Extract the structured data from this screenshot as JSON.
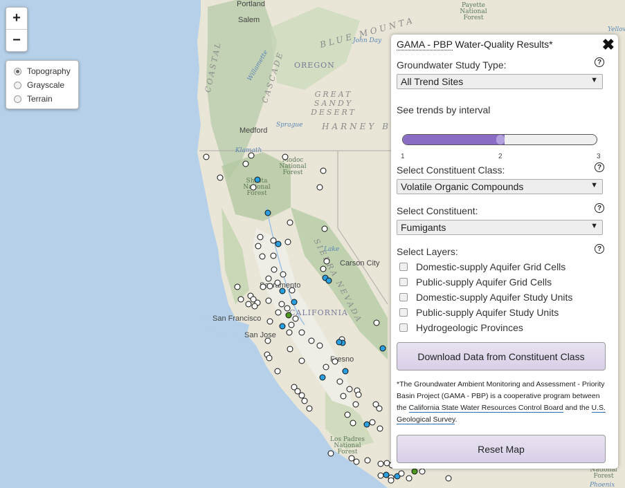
{
  "map": {
    "labels": {
      "portland": "Portland",
      "salem": "Salem",
      "medford": "Medford",
      "carson_city": "Carson City",
      "sacramento": "Sacramento",
      "san_francisco": "San Francisco",
      "san_jose": "San Jose",
      "fresno": "Fresno",
      "oregon": "OREGON",
      "california": "CALIFORNIA",
      "great_sandy_desert": "GREAT SANDY DESERT",
      "harney_basin": "HARNEY B",
      "blue_mountains": "BLUE MOUNTA",
      "coast_ranges": "COASTAL",
      "cascade": "CASCADE",
      "sierra_nevada": "SIERRA NEVADA",
      "modoc_forest": "Modoc National Forest",
      "shasta_forest": "Shasta National Forest",
      "payette_forest": "Payette National Forest",
      "los_padres_forest": "Los Padres National Forest",
      "national_forest_se": "National Forest",
      "john_day": "John Day",
      "klamath": "Klamath",
      "sprague": "Sprague",
      "willamette": "Willamette",
      "lake": "Lake",
      "phoenix": "Phoenix",
      "yellow": "Yellow"
    },
    "site_colors": {
      "empty": "#ffffff",
      "blue": "#2aa0e0",
      "green": "#4f9b1f"
    }
  },
  "zoom": {
    "in_label": "+",
    "out_label": "−"
  },
  "basemap": {
    "options": [
      {
        "label": "Topography",
        "selected": true
      },
      {
        "label": "Grayscale",
        "selected": false
      },
      {
        "label": "Terrain",
        "selected": false
      }
    ]
  },
  "panel": {
    "title_abbr": "GAMA - PBP",
    "title_rest": " Water-Quality Results*",
    "close_icon": "✖",
    "study_type": {
      "label": "Groundwater Study Type:",
      "value": "All Trend Sites"
    },
    "interval": {
      "label": "See trends by interval",
      "ticks": [
        "1",
        "2",
        "3"
      ],
      "value": 2
    },
    "constituent_class": {
      "label": "Select Constituent Class:",
      "value": "Volatile Organic Compounds"
    },
    "constituent": {
      "label": "Select Constituent:",
      "value": "Fumigants"
    },
    "layers": {
      "label": "Select Layers:",
      "items": [
        {
          "label": "Domestic-supply Aquifer Grid Cells",
          "checked": false
        },
        {
          "label": "Public-supply Aquifer Grid Cells",
          "checked": false
        },
        {
          "label": "Domestic-supply Aquifer Study Units",
          "checked": false
        },
        {
          "label": "Public-supply Aquifer Study Units",
          "checked": false
        },
        {
          "label": "Hydrogeologic Provinces",
          "checked": false
        }
      ]
    },
    "download_label": "Download Data from Constituent Class",
    "footnote": {
      "part1": "*The Groundwater Ambient Monitoring and Assessment - Priority Basin Project (GAMA - PBP) is a cooperative program between the ",
      "link1": "California State Water Resources Control Board",
      "part2": " and the ",
      "link2": "U.S. Geological Survey",
      "part3": "."
    },
    "reset_label": "Reset Map",
    "help_icon": "?"
  }
}
